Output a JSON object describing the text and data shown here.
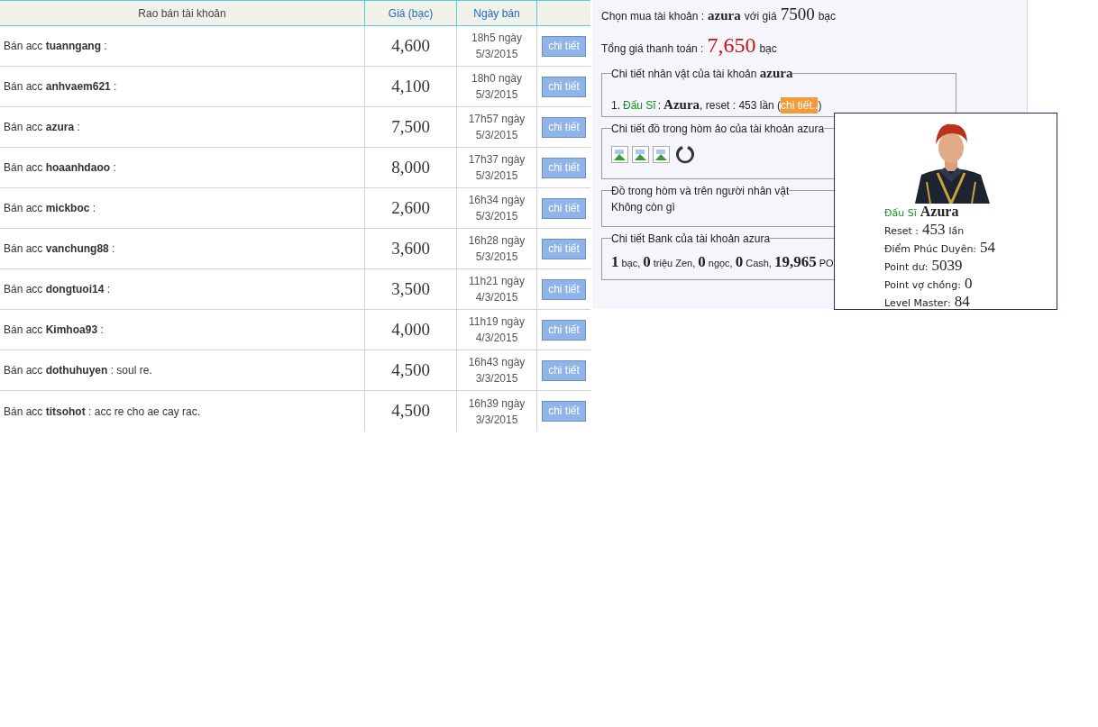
{
  "table": {
    "columns": [
      "Rao bán tài khoản",
      "Giá (bạc)",
      "Ngày bán"
    ],
    "rows": [
      {
        "listing": "Bán acc **tuanngang** :",
        "price": "4,600",
        "time": "18h5 ngày",
        "date": "5/3/2015",
        "button": "chi tiết"
      },
      {
        "listing": "Bán acc **anhvaem621** :",
        "price": "4,100",
        "time": "18h0 ngày",
        "date": "5/3/2015",
        "button": "chi tiết"
      },
      {
        "listing": "Bán acc **azura** :",
        "price": "7,500",
        "time": "17h57 ngày",
        "date": "5/3/2015",
        "button": "chi tiết"
      },
      {
        "listing": "Bán acc **hoaanhdaoo** :",
        "price": "8,000",
        "time": "17h37 ngày",
        "date": "5/3/2015",
        "button": "chi tiết"
      },
      {
        "listing": "Bán acc **mickboc** :",
        "price": "2,600",
        "time": "16h34 ngày",
        "date": "5/3/2015",
        "button": "chi tiết"
      },
      {
        "listing": "Bán acc **vanchung88** :",
        "price": "3,600",
        "time": "16h28 ngày",
        "date": "5/3/2015",
        "button": "chi tiết"
      },
      {
        "listing": "Bán acc **dongtuoi14** :",
        "price": "3,500",
        "time": "11h21 ngày",
        "date": "4/3/2015",
        "button": "chi tiết"
      },
      {
        "listing": "Bán acc **Kimhoa93** :",
        "price": "4,000",
        "time": "11h19 ngày",
        "date": "4/3/2015",
        "button": "chi tiết"
      },
      {
        "listing": "Bán acc **dothuhuyen** : soul re.",
        "price": "4,500",
        "time": "16h43 ngày",
        "date": "3/3/2015",
        "button": "chi tiết"
      },
      {
        "listing": "Bán acc **titsohot** : acc re cho ae cay rac.",
        "price": "4,500",
        "time": "16h39 ngày",
        "date": "3/3/2015",
        "button": "chi tiết"
      }
    ]
  },
  "detail": {
    "purchase_parts": [
      "Chọn mua tài khoản :",
      "azura",
      "với giá",
      "7500",
      "bạc"
    ],
    "total_label": "Tổng giá thanh toán :",
    "total": "7,650",
    "total_unit": "bạc",
    "sections": [
      {
        "kind": "characters",
        "legend": "Chi tiết nhân vật của tài khoản",
        "legend_bold": "azura",
        "index": "1.",
        "class": "Đấu Sĩ",
        "sep": ":",
        "name": "Azura",
        "reset": ", reset : 453 lần (",
        "link": "chi tiết..",
        "close": ")"
      },
      {
        "kind": "items",
        "legend": "Chi tiết đồ trong hòm ảo của tài khoản azura",
        "items": [
          {
            "kind": "broken"
          },
          {
            "kind": "broken"
          },
          {
            "kind": "broken"
          },
          {
            "kind": "ring"
          }
        ]
      },
      {
        "kind": "text",
        "legend": "Đồ trong hòm và trên người nhân vật",
        "text": "Không còn gì"
      },
      {
        "kind": "bank",
        "legend": "Chi tiết Bank của tài khoản azura",
        "parts": [
          [
            "1",
            "bạc,"
          ],
          [
            "0",
            "triệu Zen,"
          ],
          [
            "0",
            "ngọc,"
          ],
          [
            "0",
            "Cash,"
          ],
          [
            "19,965",
            "PO"
          ]
        ]
      }
    ]
  },
  "tooltip": {
    "class": "Đấu Sĩ",
    "name": "Azura",
    "stats": [
      {
        "label": "Reset :",
        "value": "453",
        "unit": "lần"
      },
      {
        "label": "Điểm Phúc Duyên:",
        "value": "54"
      },
      {
        "label": "Point dư:",
        "value": "5039"
      },
      {
        "label": "Point vợ chồng:",
        "value": "0"
      },
      {
        "label": "Level Master:",
        "value": "84"
      }
    ]
  }
}
